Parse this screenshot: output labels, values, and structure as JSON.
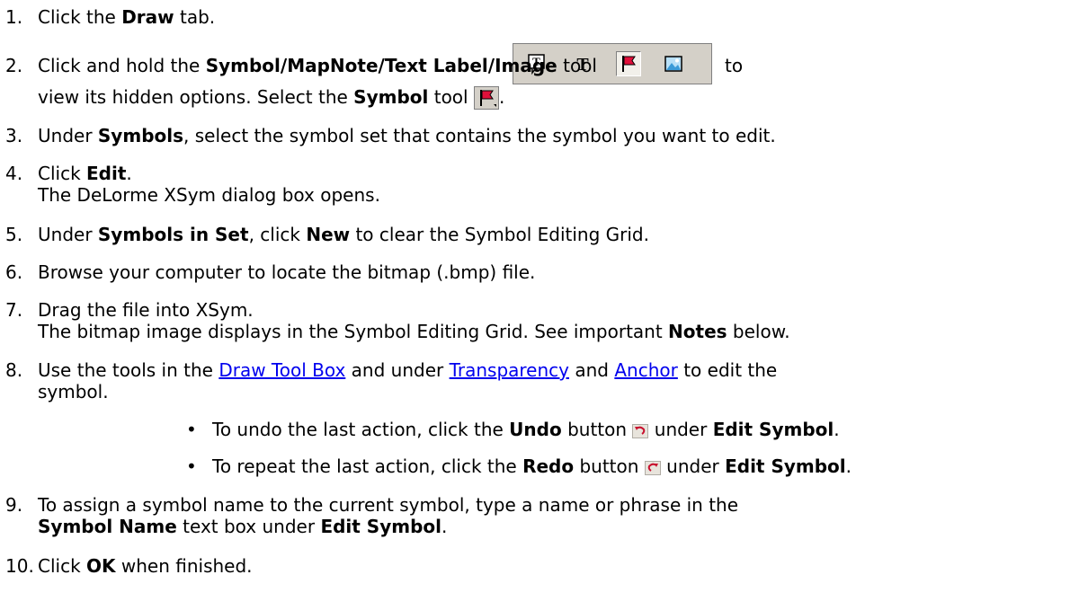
{
  "steps": [
    {
      "num": "1.",
      "a": "Click the ",
      "b": "Draw",
      "c": " tab."
    },
    {
      "num": "2.",
      "a": "Click and hold the ",
      "b": "Symbol/MapNote/Text Label/Image",
      "c": " tool",
      "d": "to",
      "line2_a": "view its hidden options. Select the ",
      "line2_b": "Symbol",
      "line2_c": " tool",
      "line2_d": "."
    },
    {
      "num": "3.",
      "a": "Under ",
      "b": "Symbols",
      "c": ", select the symbol set that contains the symbol you want to edit."
    },
    {
      "num": "4.",
      "a": "Click ",
      "b": "Edit",
      "c": ".",
      "line2": "The DeLorme XSym dialog box opens."
    },
    {
      "num": "5.",
      "a": "Under ",
      "b": "Symbols in Set",
      "c": ", click ",
      "d": "New",
      "e": " to clear the Symbol Editing Grid."
    },
    {
      "num": "6.",
      "a": "Browse your computer to locate the bitmap (.bmp) file."
    },
    {
      "num": "7.",
      "a": "Drag the file into XSym.",
      "line2_a": "The bitmap image displays in the Symbol Editing Grid. See important ",
      "line2_b": "Notes",
      "line2_c": " below."
    },
    {
      "num": "8.",
      "a": "Use the tools in the ",
      "link1": "Draw Tool Box",
      "b": " and under ",
      "link2": "Transparency",
      "c": " and ",
      "link3": "Anchor",
      "d": " to edit the",
      "line2": "symbol."
    },
    {
      "num": "9.",
      "a": "To assign a symbol name to the current symbol, type a name or phrase in the",
      "line2_a": "Symbol Name",
      "line2_b": " text box under ",
      "line2_c": "Edit Symbol",
      "line2_d": "."
    },
    {
      "num": "10.",
      "a": "Click ",
      "b": "OK",
      "c": " when finished."
    }
  ],
  "bullets": [
    {
      "a": "To undo the last action, click the ",
      "b": "Undo",
      "c": " button",
      "d": " under ",
      "e": "Edit Symbol",
      "f": "."
    },
    {
      "a": "To repeat the last action, click the ",
      "b": "Redo",
      "c": " button",
      "d": " under ",
      "e": "Edit Symbol",
      "f": "."
    }
  ],
  "icons": {
    "toolbar": [
      "mapnote-icon",
      "text-label-icon",
      "symbol-flag-icon",
      "image-icon"
    ],
    "undo": "undo-icon",
    "redo": "redo-icon"
  },
  "colors": {
    "link": "#0000ee",
    "toolbar_bg": "#d4d0c8",
    "flag_red": "#e0103a"
  }
}
